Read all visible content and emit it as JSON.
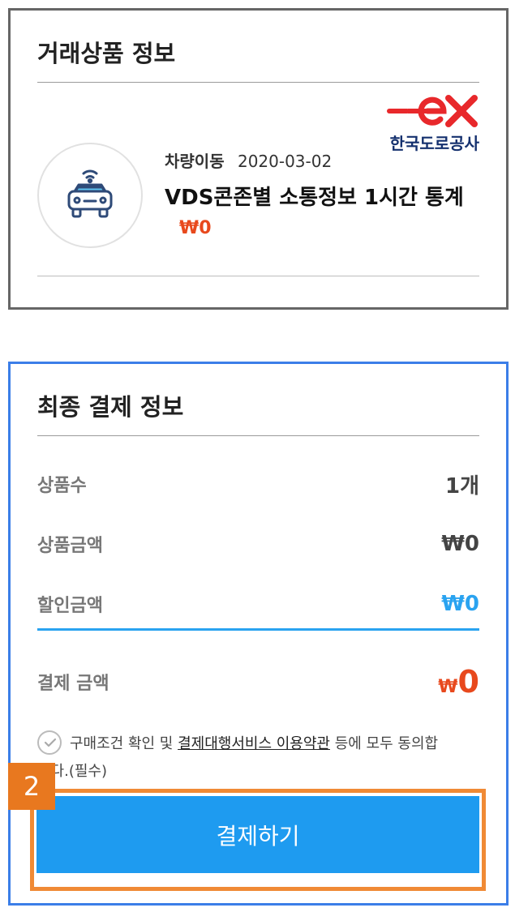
{
  "product_section": {
    "title": "거래상품 정보",
    "provider_logo_text": "한국도로공사",
    "category": "차량이동",
    "date": "2020-03-02",
    "name": "VDS콘존별 소통정보 1시간 통계",
    "price": "₩0",
    "icon": "connected-car-icon"
  },
  "payment_section": {
    "title": "최종 결제 정보",
    "rows": {
      "quantity": {
        "label": "상품수",
        "value": "1개"
      },
      "amount": {
        "label": "상품금액",
        "value": "₩0"
      },
      "discount": {
        "label": "할인금액",
        "value": "₩0"
      },
      "total": {
        "label": "결제 금액",
        "currency": "₩",
        "value": "0"
      }
    },
    "agreement": {
      "text_before": "구매조건 확인 및 ",
      "link": "결제대행서비스 이용약관",
      "text_after": " 등에 모두 동의합니다.(필수)"
    },
    "pay_button": "결제하기",
    "step_badge": "2"
  },
  "colors": {
    "price_accent": "#e8491d",
    "discount_accent": "#2aa3f0",
    "pay_button": "#1e9bf0",
    "highlight_frame": "#f08a35",
    "payment_card_border": "#3b7ee8"
  }
}
